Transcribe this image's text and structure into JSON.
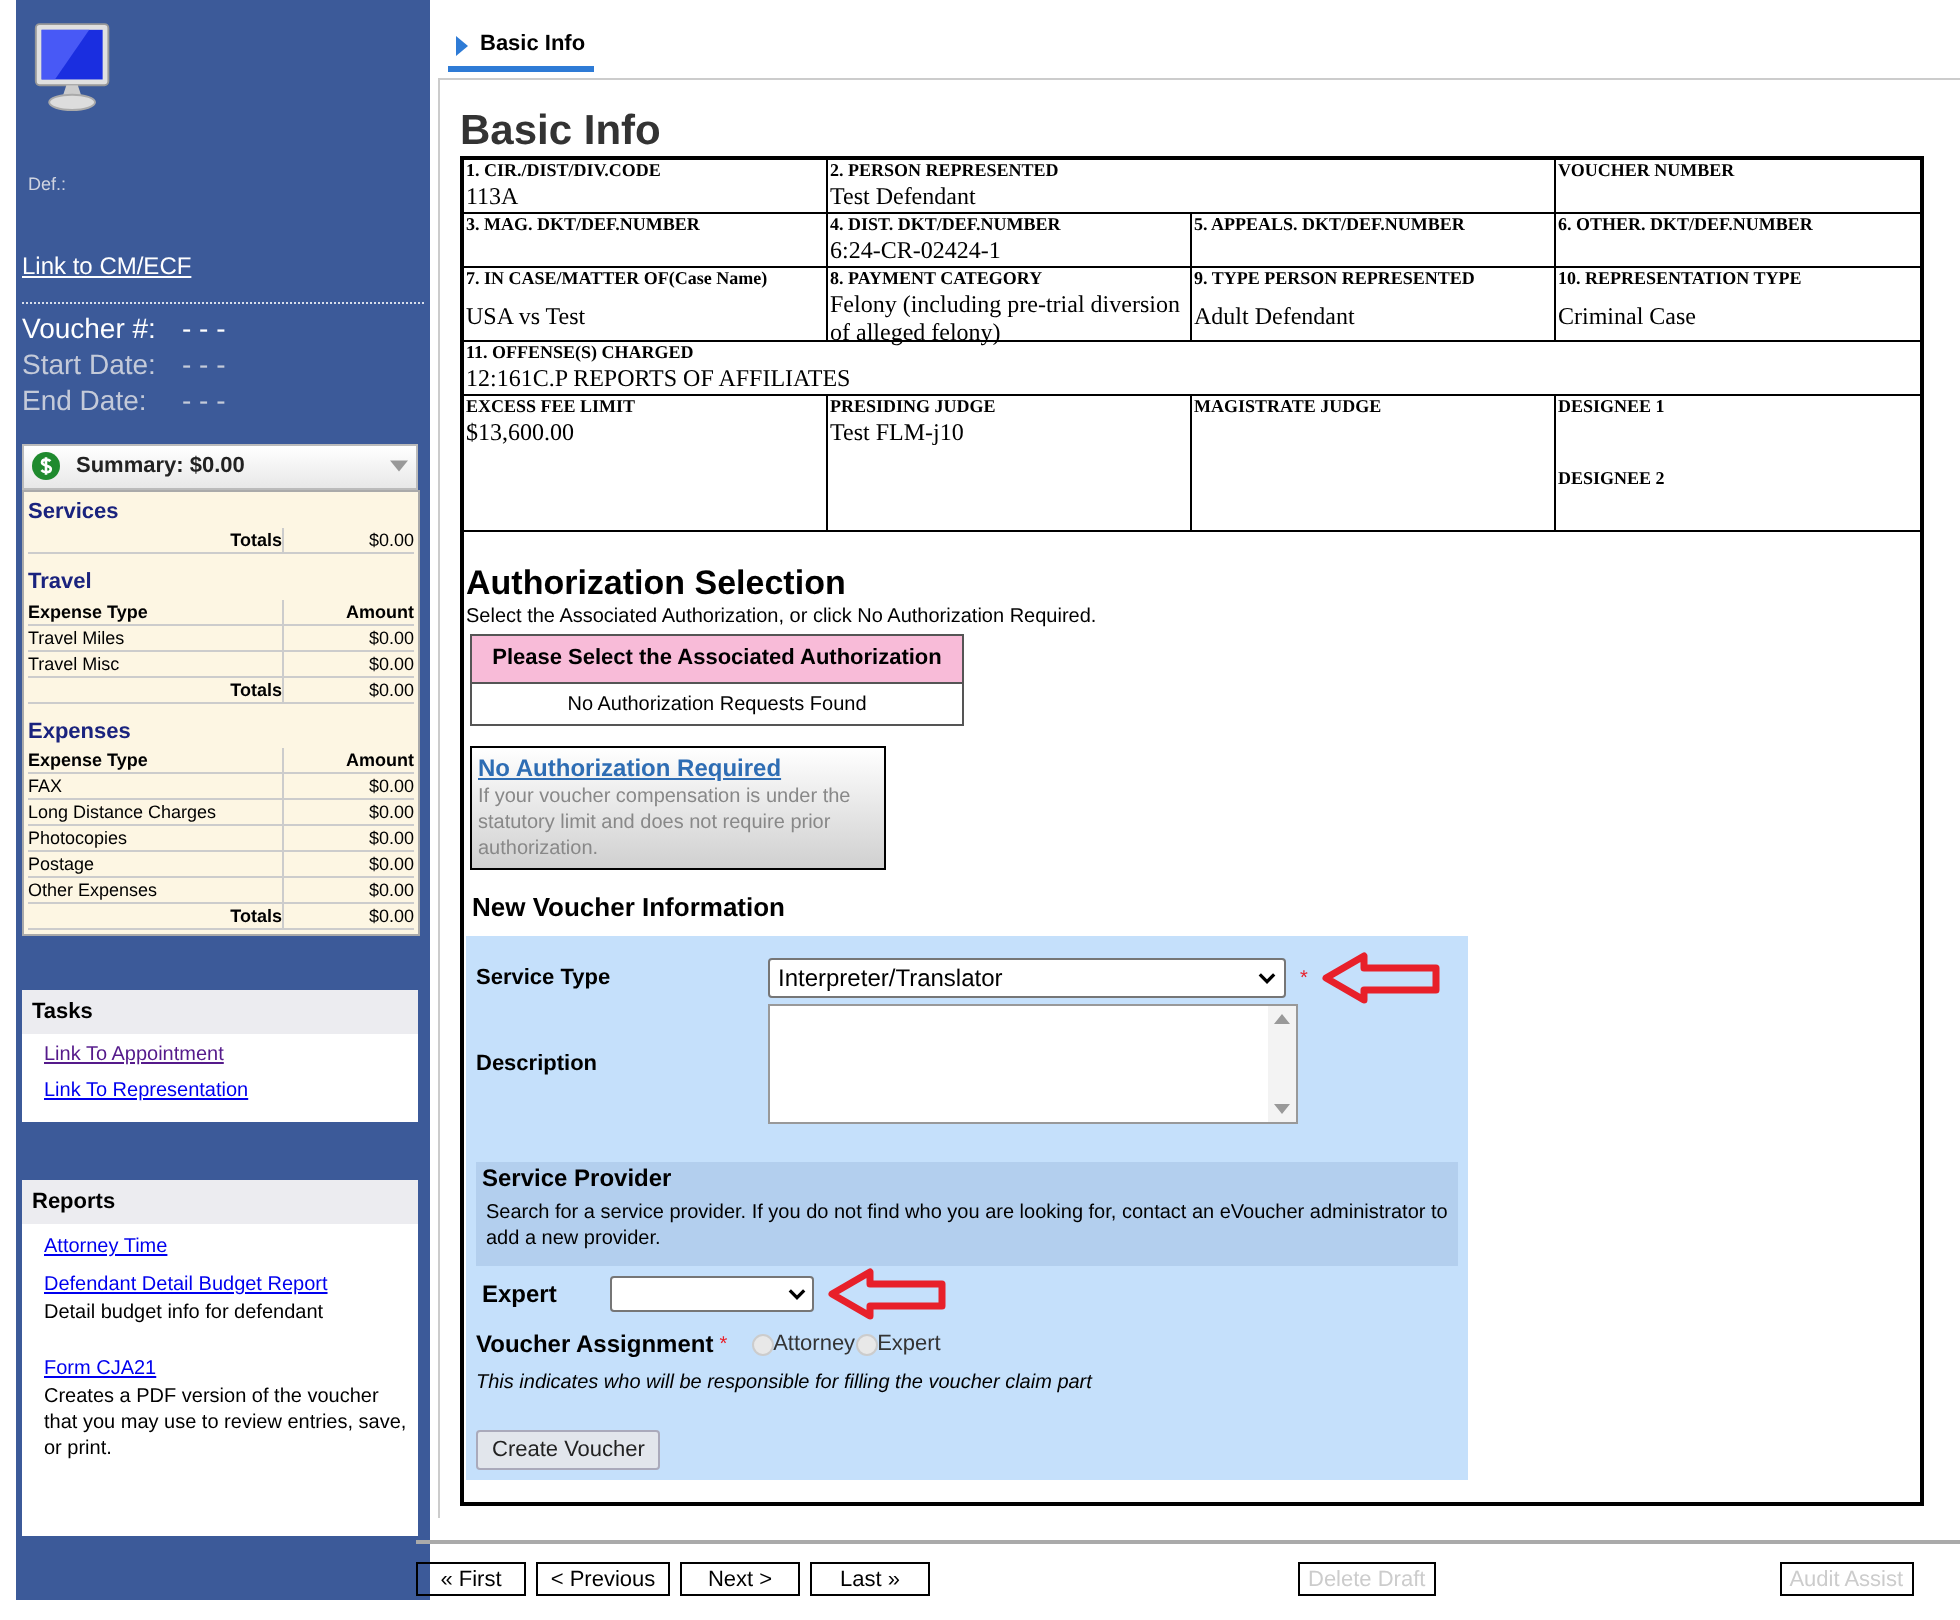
{
  "sidebar": {
    "def_label": "Def.:",
    "cmecf_link": "Link to CM/ECF",
    "voucher_fields": [
      {
        "label": "Voucher #:",
        "value": "- - -",
        "emphasis": true
      },
      {
        "label": "Start Date:",
        "value": "- - -",
        "emphasis": false
      },
      {
        "label": "End Date:",
        "value": "- - -",
        "emphasis": false
      }
    ],
    "summary": {
      "title": "Summary: $0.00",
      "sections": [
        {
          "title": "Services",
          "totals_label": "Totals",
          "totals": "$0.00"
        },
        {
          "title": "Travel",
          "columns": [
            "Expense Type",
            "Amount"
          ],
          "rows": [
            {
              "name": "Travel Miles",
              "amount": "$0.00"
            },
            {
              "name": "Travel Misc",
              "amount": "$0.00"
            }
          ],
          "totals_label": "Totals",
          "totals": "$0.00"
        },
        {
          "title": "Expenses",
          "columns": [
            "Expense Type",
            "Amount"
          ],
          "rows": [
            {
              "name": "FAX",
              "amount": "$0.00"
            },
            {
              "name": "Long Distance Charges",
              "amount": "$0.00"
            },
            {
              "name": "Photocopies",
              "amount": "$0.00"
            },
            {
              "name": "Postage",
              "amount": "$0.00"
            },
            {
              "name": "Other Expenses",
              "amount": "$0.00"
            }
          ],
          "totals_label": "Totals",
          "totals": "$0.00"
        }
      ]
    },
    "tasks": {
      "title": "Tasks",
      "links": [
        {
          "label": "Link To Appointment",
          "visited": true
        },
        {
          "label": "Link To Representation",
          "visited": false
        }
      ]
    },
    "reports": {
      "title": "Reports",
      "items": [
        {
          "link": "Attorney Time"
        },
        {
          "link": "Defendant Detail Budget Report",
          "description": "Detail budget info for defendant"
        },
        {
          "link": "Form CJA21",
          "description": "Creates a PDF version of the voucher that you may use to review entries, save, or print."
        }
      ]
    }
  },
  "tabs": [
    {
      "label": "Basic Info",
      "selected": true
    }
  ],
  "basic_info": {
    "title": "Basic Info",
    "rows": [
      [
        {
          "label": "1. CIR./DIST/DIV.CODE",
          "value": "113A"
        },
        {
          "label": "2. PERSON REPRESENTED",
          "value": "Test Defendant"
        },
        "",
        {
          "label": "VOUCHER NUMBER"
        }
      ],
      [
        {
          "label": "3. MAG. DKT/DEF.NUMBER"
        },
        {
          "label": "4. DIST. DKT/DEF.NUMBER",
          "value": "6:24-CR-02424-1"
        },
        {
          "label": "5. APPEALS. DKT/DEF.NUMBER"
        },
        {
          "label": "6. OTHER. DKT/DEF.NUMBER"
        }
      ],
      [
        {
          "label": "7. IN CASE/MATTER OF(Case Name)",
          "value": "USA vs Test"
        },
        {
          "label": "8. PAYMENT CATEGORY",
          "value": "Felony (including pre-trial diversion of alleged felony)"
        },
        {
          "label": "9. TYPE PERSON REPRESENTED",
          "value": "Adult Defendant"
        },
        {
          "label": "10. REPRESENTATION TYPE",
          "value": "Criminal Case"
        }
      ],
      [
        {
          "label": "11. OFFENSE(S) CHARGED",
          "value": "12:161C.P REPORTS OF AFFILIATES"
        },
        "",
        "",
        ""
      ],
      [
        {
          "label": "EXCESS FEE LIMIT",
          "value": "$13,600.00"
        },
        {
          "label": "PRESIDING JUDGE",
          "value": "Test FLM-j10"
        },
        {
          "label": "MAGISTRATE JUDGE"
        },
        {
          "label": "DESIGNEE 1",
          "second_label": "DESIGNEE 2"
        }
      ]
    ]
  },
  "authorization": {
    "title": "Authorization Selection",
    "instruction": "Select the Associated Authorization, or click No Authorization Required.",
    "table_header": "Please Select the Associated Authorization",
    "empty_message": "No Authorization Requests Found",
    "no_auth_link": "No Authorization Required",
    "no_auth_note": "If your voucher compensation is under the statutory limit and does not require prior authorization."
  },
  "new_voucher": {
    "title": "New Voucher Information",
    "service_type": {
      "label": "Service Type",
      "value": "Interpreter/Translator",
      "required_mark": "*"
    },
    "description": {
      "label": "Description"
    },
    "service_provider": {
      "title": "Service Provider",
      "text": "Search for a service provider. If you do not find who you are looking for, contact an eVoucher administrator to add a new provider."
    },
    "expert": {
      "label": "Expert"
    },
    "assignment": {
      "label": "Voucher Assignment",
      "required_mark": "*",
      "options": [
        {
          "label": "Attorney",
          "selected": false,
          "disabled": true
        },
        {
          "label": "Expert",
          "selected": false,
          "disabled": true
        }
      ]
    },
    "note": "This indicates who will be responsible for filling the voucher claim part",
    "create_button": "Create Voucher"
  },
  "nav_buttons": [
    {
      "label": "« First",
      "disabled": false
    },
    {
      "label": "< Previous",
      "disabled": false
    },
    {
      "label": "Next >",
      "disabled": false
    },
    {
      "label": "Last »",
      "disabled": false
    }
  ],
  "action_buttons": [
    {
      "label": "Delete Draft",
      "disabled": true
    },
    {
      "label": "Audit Assist",
      "disabled": true
    }
  ]
}
